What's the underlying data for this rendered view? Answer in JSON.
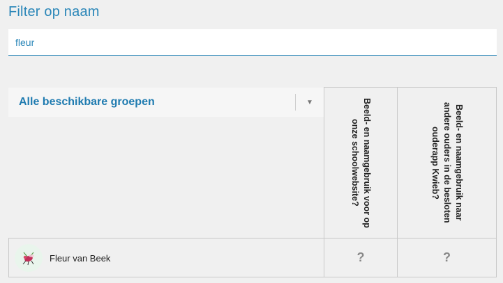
{
  "filter": {
    "title": "Filter op naam",
    "value": "fleur"
  },
  "group_select": {
    "selected": "Alle beschikbare groepen"
  },
  "columns": [
    {
      "label": "Beeld- en naamgebruik voor op onze schoolwebsite?"
    },
    {
      "label": "Beeld- en naamgebruik naar andere ouders in de besloten ouderapp Kwieb?"
    }
  ],
  "rows": [
    {
      "name": "Fleur van Beek",
      "avatar_icon": "insect-icon",
      "cells": [
        "?",
        "?"
      ]
    }
  ],
  "colors": {
    "accent": "#2a86b8",
    "background": "#f0f0f0"
  }
}
